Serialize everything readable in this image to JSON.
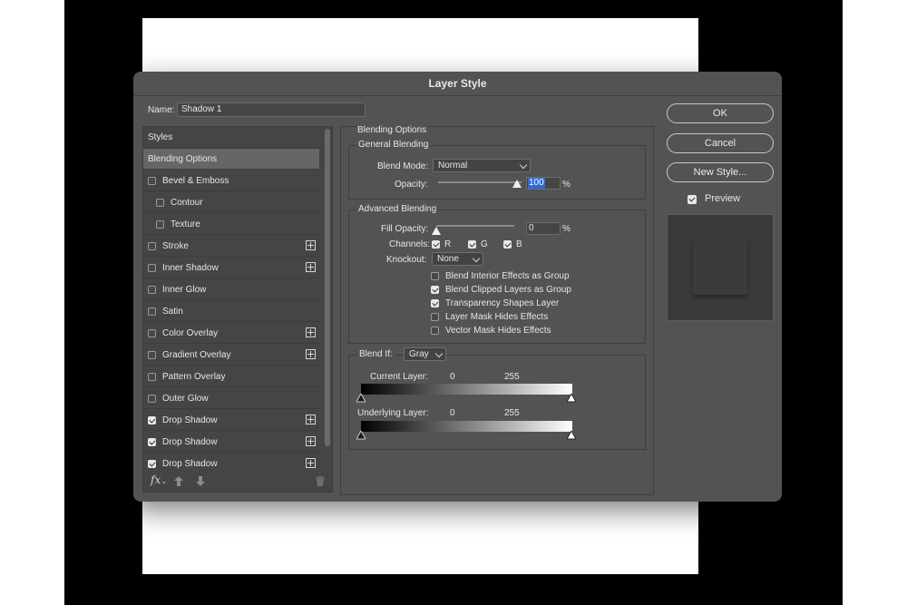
{
  "dialog": {
    "title": "Layer Style"
  },
  "name": {
    "label": "Name:",
    "value": "Shadow 1"
  },
  "styles_list": {
    "header": "Styles",
    "items": [
      {
        "label": "Blending Options",
        "checkbox": false,
        "checked": false,
        "plus": false,
        "active": true,
        "indent": 0
      },
      {
        "label": "Bevel & Emboss",
        "checkbox": true,
        "checked": false,
        "plus": false,
        "active": false,
        "indent": 0
      },
      {
        "label": "Contour",
        "checkbox": true,
        "checked": false,
        "plus": false,
        "active": false,
        "indent": 1
      },
      {
        "label": "Texture",
        "checkbox": true,
        "checked": false,
        "plus": false,
        "active": false,
        "indent": 1
      },
      {
        "label": "Stroke",
        "checkbox": true,
        "checked": false,
        "plus": true,
        "active": false,
        "indent": 0
      },
      {
        "label": "Inner Shadow",
        "checkbox": true,
        "checked": false,
        "plus": true,
        "active": false,
        "indent": 0
      },
      {
        "label": "Inner Glow",
        "checkbox": true,
        "checked": false,
        "plus": false,
        "active": false,
        "indent": 0
      },
      {
        "label": "Satin",
        "checkbox": true,
        "checked": false,
        "plus": false,
        "active": false,
        "indent": 0
      },
      {
        "label": "Color Overlay",
        "checkbox": true,
        "checked": false,
        "plus": true,
        "active": false,
        "indent": 0
      },
      {
        "label": "Gradient Overlay",
        "checkbox": true,
        "checked": false,
        "plus": true,
        "active": false,
        "indent": 0
      },
      {
        "label": "Pattern Overlay",
        "checkbox": true,
        "checked": false,
        "plus": false,
        "active": false,
        "indent": 0
      },
      {
        "label": "Outer Glow",
        "checkbox": true,
        "checked": false,
        "plus": false,
        "active": false,
        "indent": 0
      },
      {
        "label": "Drop Shadow",
        "checkbox": true,
        "checked": true,
        "plus": true,
        "active": false,
        "indent": 0
      },
      {
        "label": "Drop Shadow",
        "checkbox": true,
        "checked": true,
        "plus": true,
        "active": false,
        "indent": 0
      },
      {
        "label": "Drop Shadow",
        "checkbox": true,
        "checked": true,
        "plus": true,
        "active": false,
        "indent": 0
      }
    ],
    "bottom_icons": [
      "fx-icon",
      "move-up-icon",
      "move-down-icon",
      "trash-icon"
    ],
    "fx_label": "fx"
  },
  "blending": {
    "section_title": "Blending Options",
    "general": {
      "title": "General Blending",
      "blend_mode_label": "Blend Mode:",
      "blend_mode_value": "Normal",
      "opacity_label": "Opacity:",
      "opacity_value": "100",
      "opacity_unit": "%",
      "opacity_fraction": 1.0
    },
    "advanced": {
      "title": "Advanced Blending",
      "fill_opacity_label": "Fill Opacity:",
      "fill_opacity_value": "0",
      "fill_opacity_unit": "%",
      "fill_opacity_fraction": 0.0,
      "channels_label": "Channels:",
      "channels": [
        {
          "label": "R",
          "checked": true
        },
        {
          "label": "G",
          "checked": true
        },
        {
          "label": "B",
          "checked": true
        }
      ],
      "knockout_label": "Knockout:",
      "knockout_value": "None",
      "options": [
        {
          "label": "Blend Interior Effects as Group",
          "checked": false
        },
        {
          "label": "Blend Clipped Layers as Group",
          "checked": true
        },
        {
          "label": "Transparency Shapes Layer",
          "checked": true
        },
        {
          "label": "Layer Mask Hides Effects",
          "checked": false
        },
        {
          "label": "Vector Mask Hides Effects",
          "checked": false
        }
      ]
    },
    "blend_if": {
      "label": "Blend If:",
      "value": "Gray",
      "current_layer_label": "Current Layer:",
      "current_min": "0",
      "current_max": "255",
      "underlying_layer_label": "Underlying Layer:",
      "underlying_min": "0",
      "underlying_max": "255"
    }
  },
  "buttons": {
    "ok": "OK",
    "cancel": "Cancel",
    "new_style": "New Style..."
  },
  "preview": {
    "label": "Preview",
    "checked": true
  },
  "colors": {
    "dialog_bg": "#535353",
    "panel_bg": "#454545",
    "highlight": "#2d6bd3",
    "active_row": "#666666"
  }
}
